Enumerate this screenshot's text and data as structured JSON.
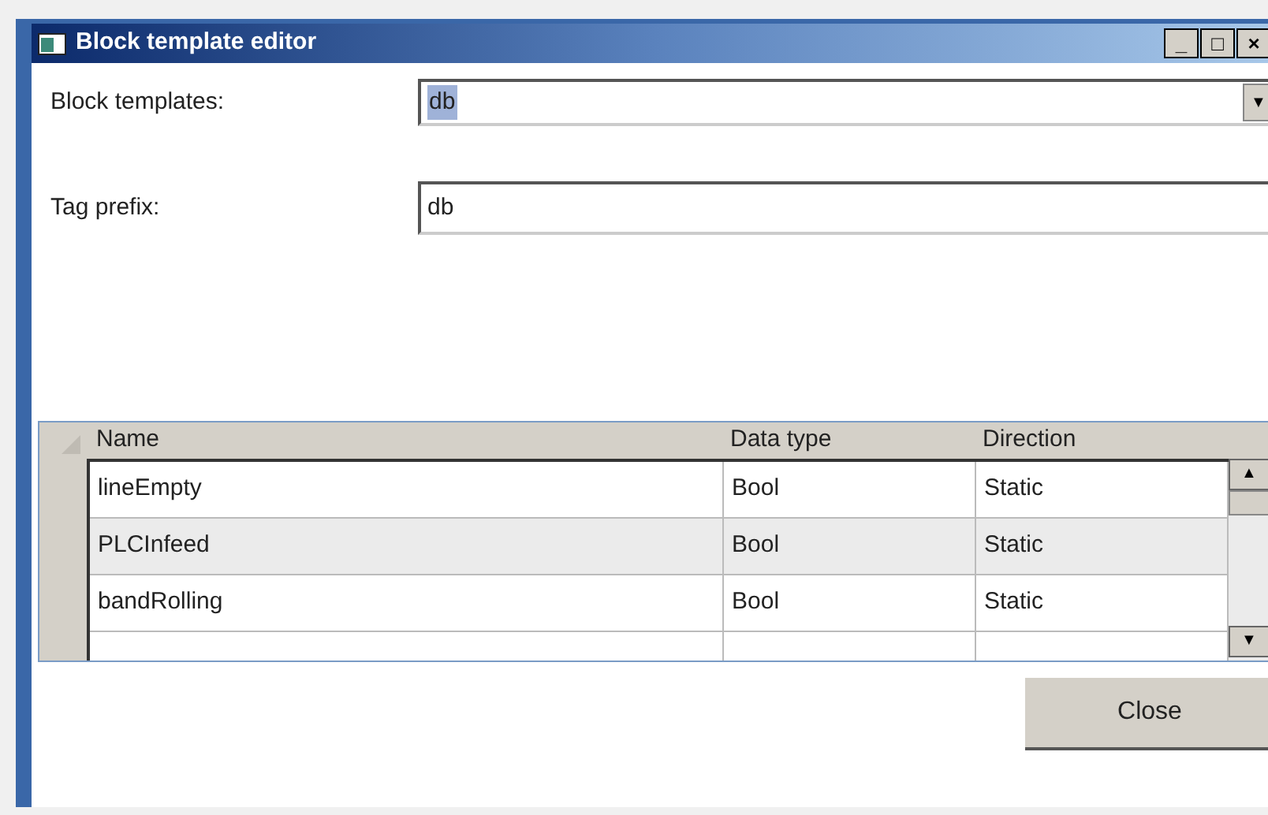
{
  "window": {
    "title": "Block template editor",
    "controls": [
      "_",
      "□",
      "×"
    ]
  },
  "block_templates": {
    "label": "Block templates:",
    "value": "db",
    "arrow": "▼"
  },
  "tag_prefix": {
    "label": "Tag prefix:",
    "value": "db"
  },
  "table": {
    "columns": [
      "Name",
      "Data type",
      "Direction"
    ],
    "rows": [
      {
        "cells": [
          "lineEmpty",
          "Bool",
          "Static"
        ]
      },
      {
        "cells": [
          "PLCInfeed",
          "Bool",
          "Static"
        ]
      },
      {
        "cells": [
          "bandRolling",
          "Bool",
          "Static"
        ]
      }
    ],
    "scroll_up": "▲",
    "scroll_down": "▼"
  },
  "buttons": [
    "Close"
  ]
}
